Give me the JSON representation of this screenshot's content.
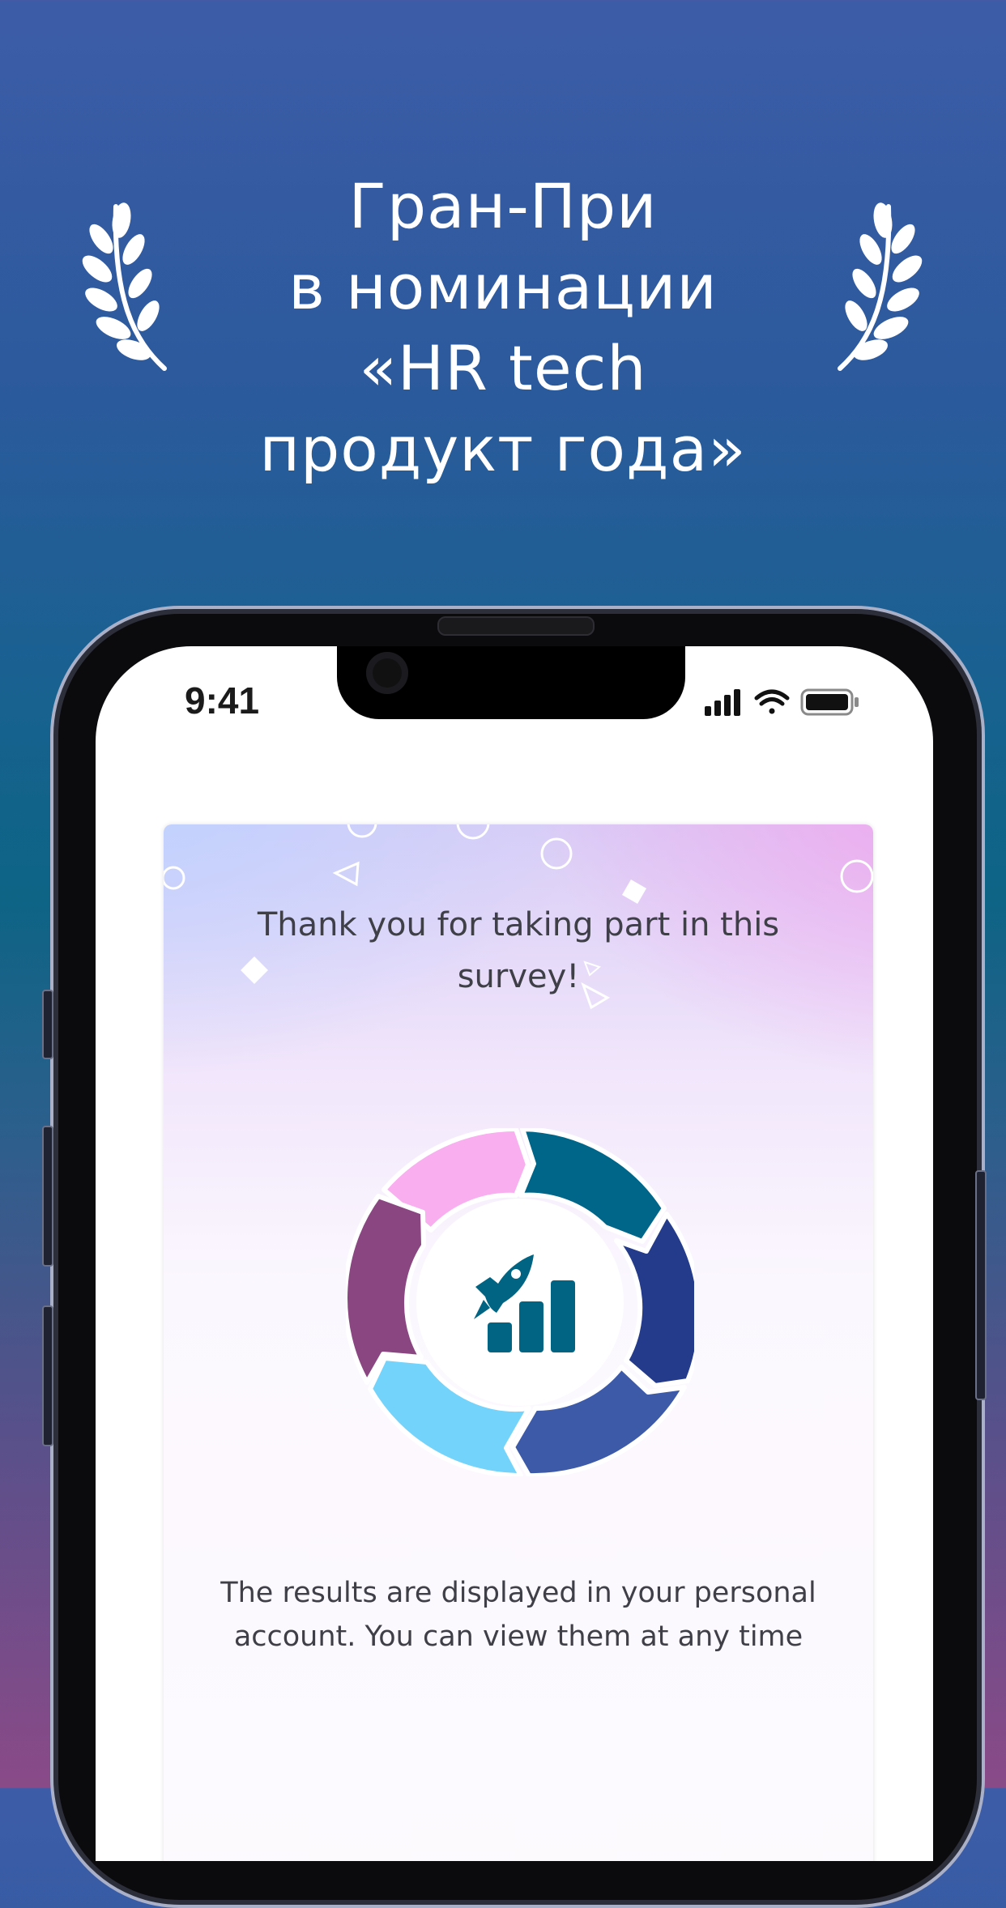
{
  "promo": {
    "headline_lines": [
      "Гран-При",
      "в номинации",
      "«HR tech",
      "продукт года»"
    ]
  },
  "status_bar": {
    "time": "9:41",
    "icons": [
      "cellular-signal-icon",
      "wifi-icon",
      "battery-icon"
    ]
  },
  "survey_card": {
    "thanks_text": "Thank you for taking part in this survey!",
    "results_text": "The results are displayed in your personal account. You can view them at any time",
    "illustration": "rocket-growth-cycle-icon"
  },
  "colors": {
    "background_top": "#3d5ca8",
    "background_middle": "#0d6485",
    "background_bottom": "#8a4a88",
    "cycle_segments": [
      "#f9aef0",
      "#006689",
      "#243a8a",
      "#3d5aa9",
      "#73d3fb",
      "#8a4681"
    ],
    "icon_teal": "#006482"
  }
}
